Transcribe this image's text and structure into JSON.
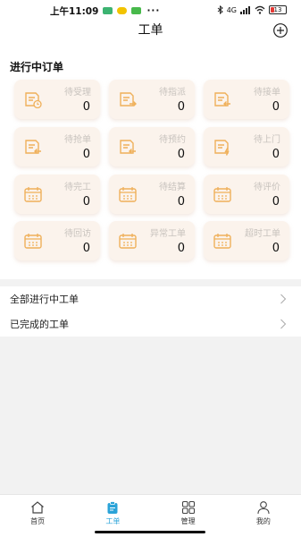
{
  "status_bar": {
    "time": "上午11:09",
    "battery": "13",
    "network": "4G"
  },
  "header": {
    "title": "工单"
  },
  "section": {
    "title": "进行中订单"
  },
  "tiles": [
    {
      "label": "待受理",
      "value": "0",
      "icon": "clock-document-icon"
    },
    {
      "label": "待指派",
      "value": "0",
      "icon": "send-document-icon"
    },
    {
      "label": "待接单",
      "value": "0",
      "icon": "receive-document-icon"
    },
    {
      "label": "待抢单",
      "value": "0",
      "icon": "receive-document-icon"
    },
    {
      "label": "待预约",
      "value": "0",
      "icon": "receive-document-icon"
    },
    {
      "label": "待上门",
      "value": "0",
      "icon": "lightning-document-icon"
    },
    {
      "label": "待完工",
      "value": "0",
      "icon": "calendar-icon"
    },
    {
      "label": "待结算",
      "value": "0",
      "icon": "calendar-icon"
    },
    {
      "label": "待评价",
      "value": "0",
      "icon": "calendar-icon"
    },
    {
      "label": "待回访",
      "value": "0",
      "icon": "calendar-icon"
    },
    {
      "label": "异常工单",
      "value": "0",
      "icon": "calendar-icon"
    },
    {
      "label": "超时工单",
      "value": "0",
      "icon": "calendar-icon"
    }
  ],
  "list": [
    {
      "label": "全部进行中工单"
    },
    {
      "label": "已完成的工单"
    }
  ],
  "tabbar": [
    {
      "label": "首页",
      "icon": "home-icon"
    },
    {
      "label": "工单",
      "icon": "clipboard-icon"
    },
    {
      "label": "管理",
      "icon": "grid-icon"
    },
    {
      "label": "我的",
      "icon": "user-icon"
    }
  ],
  "colors": {
    "accent": "#2aa3d8",
    "tile_bg": "#fbf3ec",
    "icon_orange": "#efb05a",
    "label_gray": "#c8c3be"
  }
}
